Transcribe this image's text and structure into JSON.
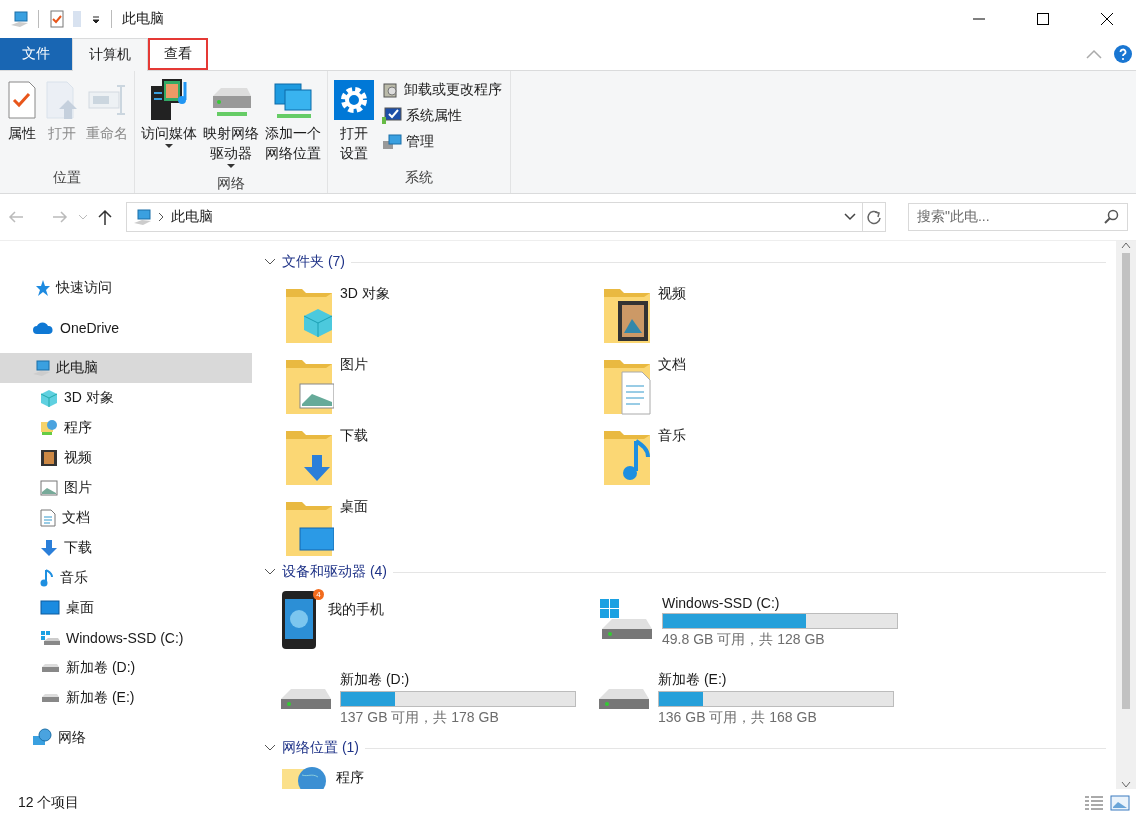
{
  "title_bar": {
    "title": "此电脑"
  },
  "ribbon": {
    "tabs": [
      {
        "label": "文件",
        "kind": "file",
        "selected": false,
        "highlighted": false
      },
      {
        "label": "计算机",
        "kind": "tab",
        "selected": true,
        "highlighted": false
      },
      {
        "label": "查看",
        "kind": "tab",
        "selected": false,
        "highlighted": true
      }
    ],
    "groups": [
      {
        "label": "位置",
        "buttons": [
          {
            "lines": [
              "属性"
            ],
            "kind": "large",
            "disabled": false,
            "dropdown": false
          },
          {
            "lines": [
              "打开"
            ],
            "kind": "large",
            "disabled": true,
            "dropdown": false
          },
          {
            "lines": [
              "重命名"
            ],
            "kind": "large",
            "disabled": true,
            "dropdown": false
          }
        ]
      },
      {
        "label": "网络",
        "buttons": [
          {
            "lines": [
              "访问媒体"
            ],
            "kind": "large",
            "disabled": false,
            "dropdown": true
          },
          {
            "lines": [
              "映射网络",
              "驱动器"
            ],
            "kind": "large",
            "disabled": false,
            "dropdown": true
          },
          {
            "lines": [
              "添加一个",
              "网络位置"
            ],
            "kind": "large",
            "disabled": false,
            "dropdown": false
          }
        ]
      },
      {
        "label": "系统",
        "buttons": [
          {
            "lines": [
              "打开",
              "设置"
            ],
            "kind": "large",
            "disabled": false,
            "dropdown": false
          },
          {
            "lines": [
              "卸载或更改程序"
            ],
            "kind": "small",
            "disabled": false,
            "dropdown": false
          },
          {
            "lines": [
              "系统属性"
            ],
            "kind": "small",
            "disabled": false,
            "dropdown": false
          },
          {
            "lines": [
              "管理"
            ],
            "kind": "small",
            "disabled": false,
            "dropdown": false
          }
        ]
      }
    ]
  },
  "address_bar": {
    "path": "此电脑",
    "search_placeholder": "搜索\"此电..."
  },
  "sidebar": {
    "items": [
      {
        "label": "快速访问",
        "selected": false
      },
      {
        "label": "OneDrive",
        "selected": false
      },
      {
        "label": "此电脑",
        "selected": true,
        "children": [
          {
            "label": "3D 对象",
            "selected": false
          },
          {
            "label": "程序",
            "selected": false
          },
          {
            "label": "视频",
            "selected": false
          },
          {
            "label": "图片",
            "selected": false
          },
          {
            "label": "文档",
            "selected": false
          },
          {
            "label": "下载",
            "selected": false
          },
          {
            "label": "音乐",
            "selected": false
          },
          {
            "label": "桌面",
            "selected": false
          },
          {
            "label": "Windows-SSD (C:)",
            "selected": false
          },
          {
            "label": "新加卷 (D:)",
            "selected": false
          },
          {
            "label": "新加卷 (E:)",
            "selected": false
          }
        ]
      },
      {
        "label": "网络",
        "selected": false
      }
    ]
  },
  "sections": [
    {
      "title": "文件夹 (7)",
      "kind": "folders",
      "items": [
        {
          "name": "3D 对象"
        },
        {
          "name": "视频"
        },
        {
          "name": "图片"
        },
        {
          "name": "文档"
        },
        {
          "name": "下载"
        },
        {
          "name": "音乐"
        },
        {
          "name": "桌面"
        }
      ]
    },
    {
      "title": "设备和驱动器 (4)",
      "kind": "drives",
      "items": [
        {
          "name": "我的手机",
          "kind": "phone",
          "badge": "4"
        },
        {
          "name": "Windows-SSD (C:)",
          "kind": "drive",
          "level": 0.61,
          "space": "49.8 GB 可用，共 128 GB"
        },
        {
          "name": "新加卷 (D:)",
          "kind": "drive",
          "level": 0.23,
          "space": "137 GB 可用，共 178 GB"
        },
        {
          "name": "新加卷 (E:)",
          "kind": "drive",
          "level": 0.19,
          "space": "136 GB 可用，共 168 GB"
        }
      ]
    },
    {
      "title": "网络位置 (1)",
      "kind": "network",
      "items": [
        {
          "name": "程序"
        }
      ]
    }
  ],
  "status_bar": {
    "count": "12 个项目"
  }
}
